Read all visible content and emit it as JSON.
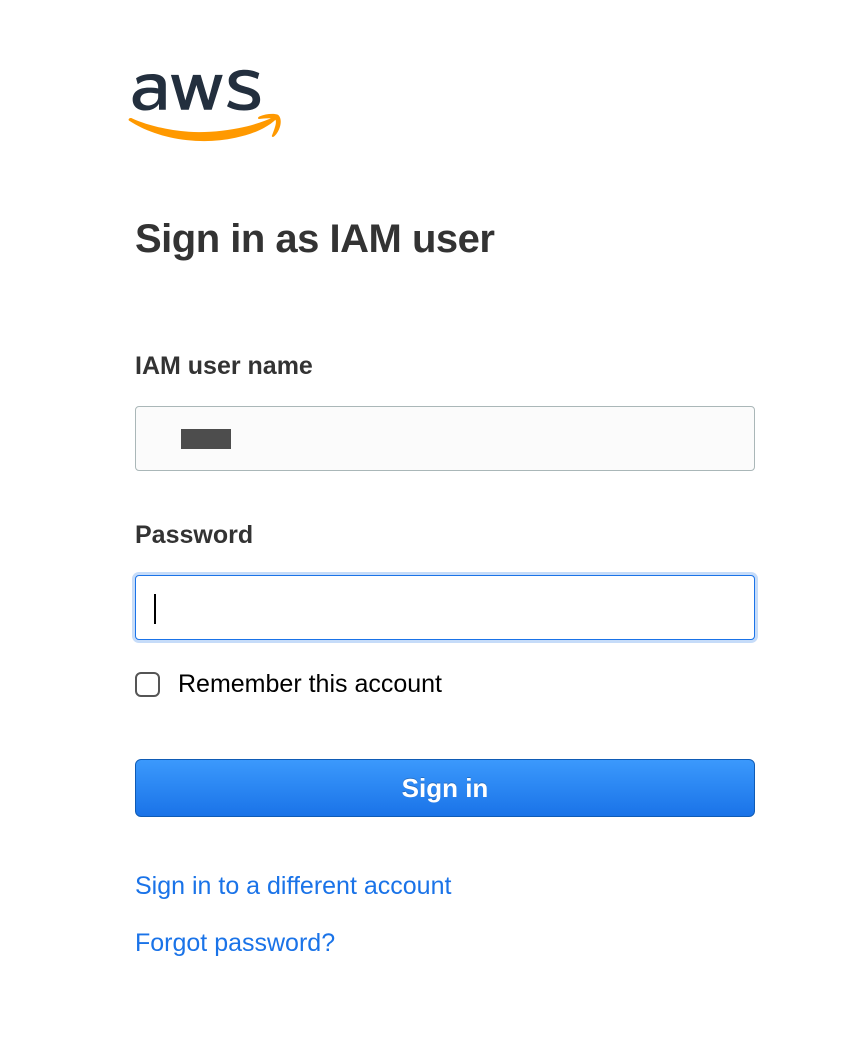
{
  "logo": {
    "name": "aws-logo"
  },
  "heading": "Sign in as IAM user",
  "form": {
    "username": {
      "label": "IAM user name",
      "value": ""
    },
    "password": {
      "label": "Password",
      "value": ""
    },
    "remember": {
      "label": "Remember this account",
      "checked": false
    },
    "submit": {
      "label": "Sign in"
    }
  },
  "links": {
    "different_account": "Sign in to a different account",
    "forgot_password": "Forgot password?"
  }
}
